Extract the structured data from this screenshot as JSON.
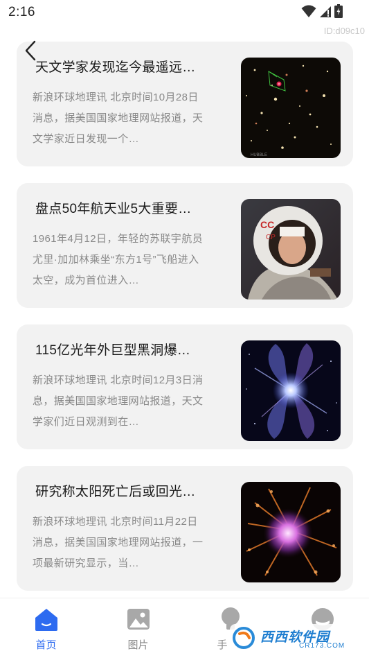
{
  "status": {
    "time": "2:16",
    "id_text": "ID:d09c10"
  },
  "articles": [
    {
      "title": "天文学家发现迄今最遥远…",
      "desc": "新浪环球地理讯 北京时间10月28日消息，据美国国家地理网站报道，天文学家近日发现一个…",
      "image": "galaxy-field-image"
    },
    {
      "title": "盘点50年航天业5大重要…",
      "desc": "1961年4月12日，年轻的苏联宇航员尤里·加加林乘坐“东方1号”飞船进入太空，成为首位进入…",
      "image": "cosmonaut-image"
    },
    {
      "title": "115亿光年外巨型黑洞爆…",
      "desc": "新浪环球地理讯 北京时间12月3日消息，据美国国家地理网站报道，天文学家们近日观测到在…",
      "image": "black-hole-jet-image"
    },
    {
      "title": "研究称太阳死亡后或回光…",
      "desc": "新浪环球地理讯 北京时间11月22日消息，据美国国家地理网站报道，一项最新研究显示，当…",
      "image": "dying-star-image"
    }
  ],
  "tabs": [
    {
      "label": "首页",
      "icon": "home-icon",
      "active": true
    },
    {
      "label": "图片",
      "icon": "image-icon",
      "active": false
    },
    {
      "label": "手",
      "icon": "bulb-icon",
      "active": false
    },
    {
      "label": "",
      "icon": "profile-icon",
      "active": false
    }
  ],
  "watermark": {
    "text": "西西软件园",
    "sub": "CR173.COM"
  },
  "colors": {
    "accent": "#2d6bf0",
    "card_bg": "#f2f2f2",
    "muted_text": "#888888"
  }
}
